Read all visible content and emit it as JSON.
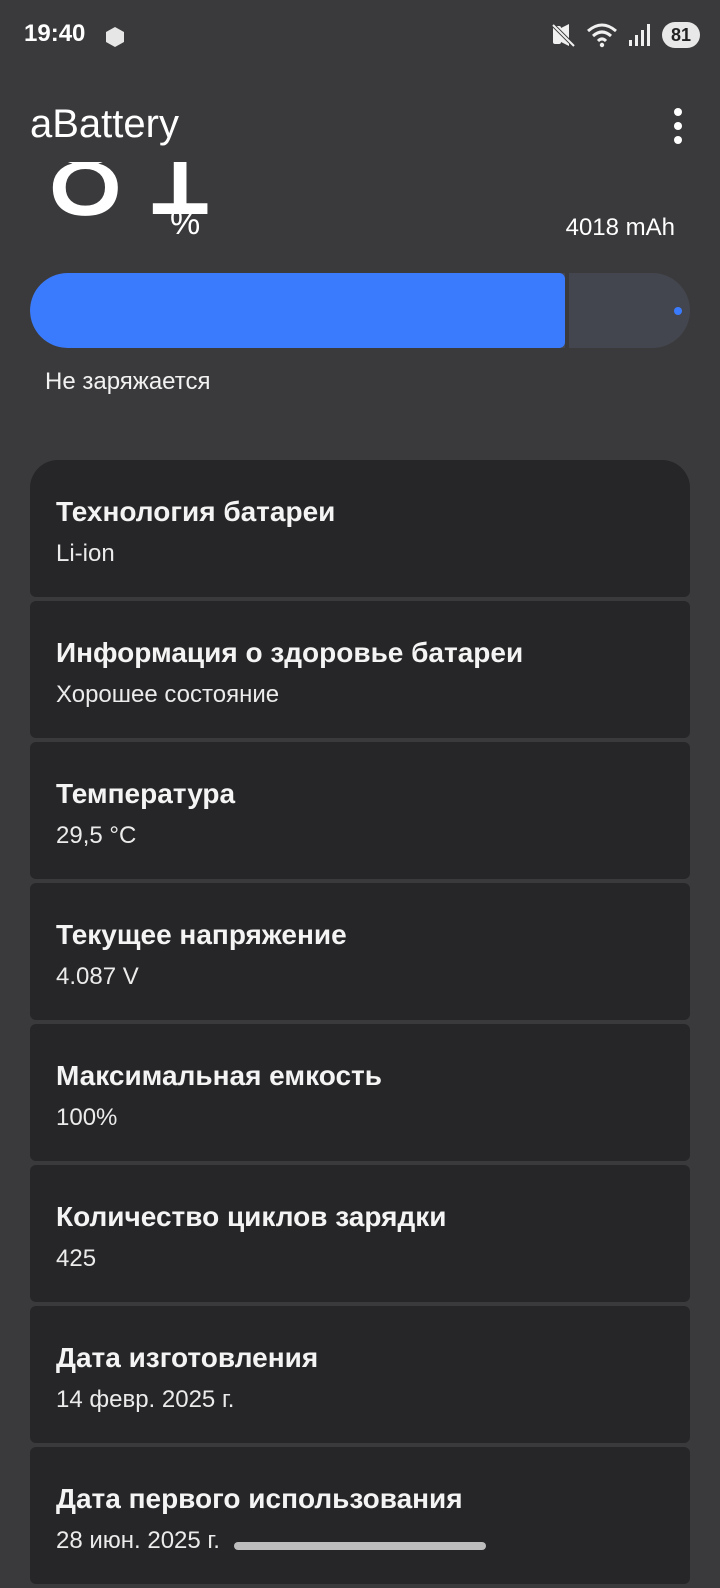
{
  "status_bar": {
    "time": "19:40",
    "battery": "81",
    "icons": [
      "hexagon-icon",
      "mute-icon",
      "wifi-icon",
      "signal-icon"
    ]
  },
  "app_bar": {
    "title": "aBattery",
    "menu_icon": "more-vert-icon"
  },
  "battery": {
    "percent": "81",
    "percent_sign": "%",
    "capacity": "4018 mAh",
    "level": 0.81,
    "status": "Не заряжается"
  },
  "colors": {
    "background": "#3a3a3c",
    "card": "#262628",
    "accent": "#3a7bfd",
    "track": "#44464f"
  },
  "cards": [
    {
      "title": "Технология батареи",
      "value": "Li-ion"
    },
    {
      "title": "Информация о здоровье батареи",
      "value": "Хорошее состояние"
    },
    {
      "title": "Температура",
      "value": "29,5 °C"
    },
    {
      "title": "Текущее напряжение",
      "value": "4.087 V"
    },
    {
      "title": "Максимальная емкость",
      "value": "100%"
    },
    {
      "title": "Количество циклов зарядки",
      "value": "425"
    },
    {
      "title": "Дата изготовления",
      "value": "14 февр. 2025 г."
    },
    {
      "title": "Дата первого использования",
      "value": "28 июн. 2025 г."
    }
  ]
}
